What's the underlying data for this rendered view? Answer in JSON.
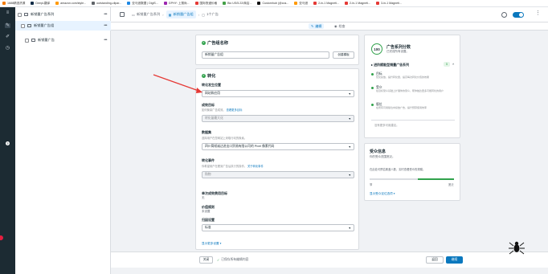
{
  "bookmarks": [
    {
      "label": "1688精选货源",
      "color": "#f57c00"
    },
    {
      "label": "DeepL翻译",
      "color": "#0f2b46"
    },
    {
      "label": "amazon.com/style...",
      "color": "#ff9900"
    },
    {
      "label": "outstanding-clipar...",
      "color": "#5f6368"
    },
    {
      "label": "亚马逊数据 | DigiS...",
      "color": "#1e88e5"
    },
    {
      "label": "GPHY: 上搜尚...",
      "color": "#9c27b0"
    },
    {
      "label": "国际快递价格",
      "color": "#e53935"
    },
    {
      "label": "Bio US/5.22/商店...",
      "color": "#43a047"
    },
    {
      "label": "Customhub (@cus...",
      "color": "#111111"
    },
    {
      "label": "亚马逊",
      "color": "#ff9900"
    },
    {
      "label": "2-in-1 Magneti...",
      "color": "#e53935"
    },
    {
      "label": "2-in-1 Magneti...",
      "color": "#e53935"
    },
    {
      "label": "3-in-1 Magneti...",
      "color": "#e53935"
    }
  ],
  "tree": {
    "rows": [
      {
        "label": "新销量广告系列",
        "dots": "•••"
      },
      {
        "label": "新销量广告组",
        "dots": "•••"
      },
      {
        "label": "新销量广告",
        "dots": "•••"
      }
    ]
  },
  "header": {
    "crumb1": "新销量广告系列",
    "crumb2": "新销量广告组",
    "crumb3": "1个广告",
    "edit": "编辑",
    "review": "检查"
  },
  "form": {
    "adset_name_title": "广告组名称",
    "adset_name_value": "新销量广告组",
    "create_template": "创建模板",
    "conversion_title": "转化",
    "conversion_location_label": "转化发生位置",
    "conversion_location_value": "网站和应用",
    "perf_goal_label": "成效目标",
    "perf_goal_sub": "如何衡量广告成效。",
    "perf_goal_link": "查看更多目标",
    "perf_goal_value": "转化量最大化",
    "dataset_label": "数据集",
    "dataset_sub": "选择用户在您网站上采取行动的像素。",
    "dataset_value": "四川简帧诚达进出口贸易有限公司的 Pixel 像素代码",
    "conversion_event_label": "转化事件",
    "conversion_event_sub": "你希望用户在看到广告后执行的操作。",
    "conversion_event_link": "关于转化事件",
    "conversion_event_value": "购物",
    "cost_goal_label": "单次成效费用目标",
    "cost_goal_value": "无",
    "value_rule_label": "价值规则",
    "value_rule_value": "未设置",
    "attribution_label": "归因设置",
    "attribution_value": "标准",
    "more_link": "显示更多设置"
  },
  "score": {
    "value": "100",
    "title": "广告系列分数",
    "sub": "已完成所有设置。",
    "section": "进阶赋能型销量广告系列",
    "badge": "5",
    "opts": [
      {
        "t": "目标",
        "d": "优化投放，提升转化量，提高每次转化价值的效果",
        "color": "#31a24c"
      },
      {
        "t": "受众",
        "d": "在目标受众基础上扩展你的受众，帮你触达更多可能转化的用户",
        "color": "#31a24c"
      },
      {
        "t": "版位",
        "d": "在所有可用版位中投放广告，提升预算使用效率",
        "color": "#31a24c"
      }
    ],
    "more": "没有更多可用建议。"
  },
  "audience": {
    "title": "受众信息",
    "sub": "你的受众范围宽泛。",
    "desc": "在此处可预估覆盖人数，实时查看受众的规模。",
    "narrow": "窄",
    "broad": "宽泛",
    "link": "显示受众定位选项"
  },
  "footer": {
    "close": "关闭",
    "saved": "已保存所有编辑内容",
    "back": "返回",
    "next": "继续"
  },
  "colors": {
    "accent": "#0a78be",
    "green": "#31a24c",
    "rail": "#1c2b33"
  }
}
